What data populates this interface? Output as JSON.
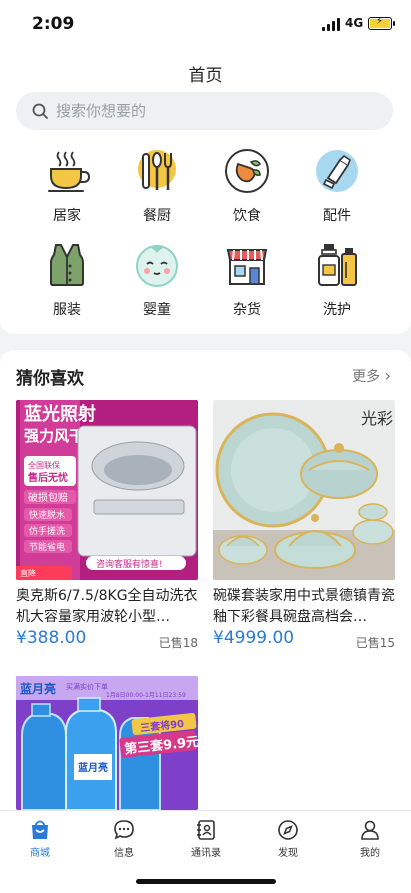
{
  "status": {
    "time": "2:09",
    "network": "4G"
  },
  "header": {
    "title": "首页"
  },
  "search": {
    "placeholder": "搜索你想要的"
  },
  "categories": [
    {
      "label": "居家",
      "icon": "coffee-cup-icon"
    },
    {
      "label": "餐厨",
      "icon": "utensils-icon"
    },
    {
      "label": "饮食",
      "icon": "food-plate-icon"
    },
    {
      "label": "配件",
      "icon": "accessory-icon"
    },
    {
      "label": "服装",
      "icon": "vest-icon"
    },
    {
      "label": "婴童",
      "icon": "baby-face-icon"
    },
    {
      "label": "杂货",
      "icon": "store-icon"
    },
    {
      "label": "洗护",
      "icon": "bottles-icon"
    }
  ],
  "guess": {
    "title": "猜你喜欢",
    "more": "更多",
    "products": [
      {
        "name": "奥克斯6/7.5/8KG全自动洗衣机大容量家用波轮小型…",
        "price": "¥388.00",
        "sold": "已售18",
        "image": {
          "banner1": "蓝光照射",
          "banner2": "强力风干",
          "badge1": "全国联保",
          "badge2": "售后无忧",
          "tag1": "破损包赔",
          "tag2": "快速脱水",
          "tag3": "仿手搓洗",
          "tag4": "节能省电",
          "notice": "咨询客服有惊喜!",
          "corner": "直降"
        }
      },
      {
        "name": "碗碟套装家用中式景德镇青瓷釉下彩餐具碗盘高档会…",
        "price": "¥4999.00",
        "sold": "已售15",
        "image": {
          "calligraphy": "光彩"
        }
      },
      {
        "name": "",
        "price": "",
        "sold": "",
        "image": {
          "brand": "蓝月亮",
          "promo1": "三套将90",
          "promo2": "第三套9.9元",
          "top_note": "买满实价下单",
          "date_note": "1月8日00:00-1月11日23:59",
          "bottle_brand": "蓝月亮"
        }
      }
    ]
  },
  "tabs": [
    {
      "label": "商城",
      "icon": "shop-bag-icon",
      "active": true
    },
    {
      "label": "信息",
      "icon": "chat-icon",
      "active": false
    },
    {
      "label": "通讯录",
      "icon": "contacts-icon",
      "active": false
    },
    {
      "label": "发现",
      "icon": "compass-icon",
      "active": false
    },
    {
      "label": "我的",
      "icon": "user-icon",
      "active": false
    }
  ],
  "colors": {
    "accent": "#2a7bd8",
    "background": "#f2f3f5",
    "card": "#ffffff",
    "icon_gold": "#f3c646",
    "icon_blue": "#a8d8f0"
  }
}
